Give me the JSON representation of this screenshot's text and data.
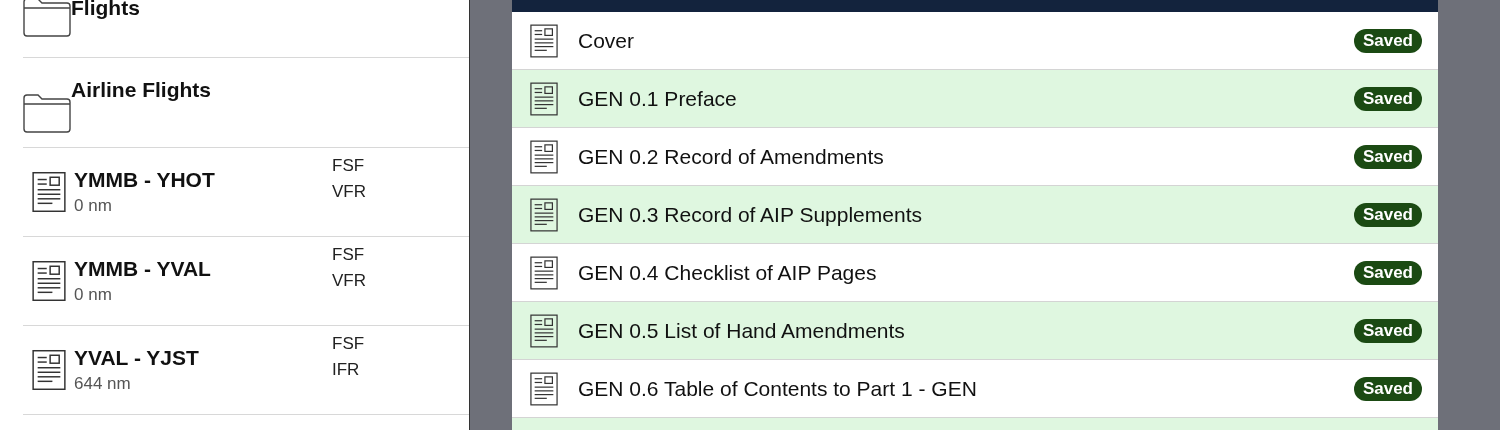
{
  "folders": [
    {
      "name": "Flights"
    },
    {
      "name": "Airline Flights"
    }
  ],
  "flights": [
    {
      "route": "YMMB - YHOT",
      "distance": "0 nm",
      "tags": [
        "FSF",
        "VFR"
      ]
    },
    {
      "route": "YMMB - YVAL",
      "distance": "0 nm",
      "tags": [
        "FSF",
        "VFR"
      ]
    },
    {
      "route": "YVAL - YJST",
      "distance": "644 nm",
      "tags": [
        "FSF",
        "IFR"
      ]
    }
  ],
  "documents": [
    {
      "title": "Cover",
      "status": "Saved",
      "shaded": false
    },
    {
      "title": "GEN 0.1 Preface",
      "status": "Saved",
      "shaded": true
    },
    {
      "title": "GEN 0.2 Record of Amendments",
      "status": "Saved",
      "shaded": false
    },
    {
      "title": "GEN 0.3 Record of AIP Supplements",
      "status": "Saved",
      "shaded": true
    },
    {
      "title": "GEN 0.4 Checklist of AIP Pages",
      "status": "Saved",
      "shaded": false
    },
    {
      "title": "GEN 0.5 List of Hand Amendments",
      "status": "Saved",
      "shaded": true
    },
    {
      "title": "GEN 0.6 Table of Contents to Part 1 - GEN",
      "status": "Saved",
      "shaded": false
    }
  ]
}
